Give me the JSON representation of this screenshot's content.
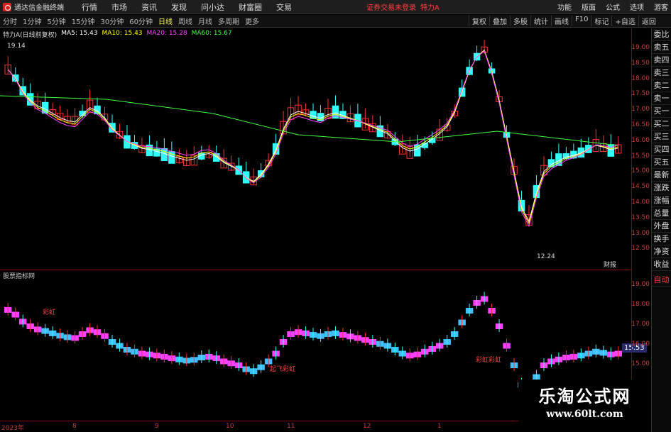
{
  "app": {
    "title": "通达信金融终端"
  },
  "menu": [
    "行情",
    "市场",
    "资讯",
    "发现",
    "问小达",
    "财富圈",
    "交易"
  ],
  "login_status": "证券交易未登录",
  "stock": "特力A",
  "sys_buttons": [
    "功能",
    "版面",
    "公式",
    "选项",
    "游客"
  ],
  "periods": [
    "分时",
    "1分钟",
    "5分钟",
    "15分钟",
    "30分钟",
    "60分钟",
    "日线",
    "周线",
    "月线",
    "多周期",
    "更多"
  ],
  "active_period": "日线",
  "tools": [
    "复权",
    "叠加",
    "多股",
    "统计",
    "画线",
    "F10",
    "标记",
    "+自选",
    "返回"
  ],
  "legend": {
    "title": "特力A(日线前复权)",
    "ma5": "MA5: 15.43",
    "ma10": "MA10: 15.43",
    "ma20": "MA20: 15.28",
    "ma60": "MA60: 15.67",
    "colors": {
      "ma5": "#ffffff",
      "ma10": "#ffff00",
      "ma20": "#ff40ff",
      "ma60": "#40ff40"
    }
  },
  "main_ticks": [
    "19.00",
    "18.50",
    "18.00",
    "17.50",
    "17.00",
    "16.50",
    "16.00",
    "15.50",
    "15.00",
    "14.50",
    "14.00",
    "13.50",
    "13.00",
    "12.50"
  ],
  "annotations": {
    "high": "19.14",
    "low": "12.24",
    "report": "财报"
  },
  "sub_legend": "股票指标网",
  "sub_ticks": [
    "19.00",
    "18.00",
    "17.00",
    "16.00",
    "15.00"
  ],
  "sub_price": "15.53",
  "sub_labels": [
    "彩虹",
    "起飞彩虹",
    "彩虹彩虹"
  ],
  "xaxis": [
    "2023年",
    "8",
    "9",
    "10",
    "11",
    "12",
    "1"
  ],
  "right_panel": [
    "委比",
    "卖五",
    "卖四",
    "卖三",
    "卖二",
    "卖一",
    "买一",
    "买二",
    "买三",
    "买四",
    "买五",
    "最新",
    "涨跌",
    "涨幅",
    "总量",
    "外盘",
    "换手",
    "净资",
    "收益",
    "自动"
  ],
  "watermark": {
    "cn": "乐淘公式网",
    "url": "www.60lt.com"
  }
}
